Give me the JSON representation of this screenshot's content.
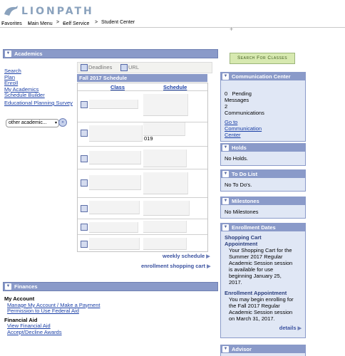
{
  "app": {
    "logo_text": "LIONPATH"
  },
  "nav": {
    "favorites": "Favorites",
    "main_menu": "Main Menu",
    "self_service": "Self Service",
    "student_center": "Student Center",
    "sep": ">"
  },
  "academics": {
    "header": "Academics",
    "links": [
      "Search",
      "Plan",
      "Enroll",
      "My Academics",
      "Schedule Builder"
    ],
    "eps": "Educational Planning Survey",
    "select_value": "other academic...",
    "go_label": "»"
  },
  "schedule": {
    "tab_deadlines": "Deadlines",
    "tab_url": "URL",
    "title": "Fall 2017 Schedule",
    "col_class": "Class",
    "col_schedule": "Schedule",
    "visible_code": "019",
    "weekly_link": "weekly schedule",
    "cart_link": "enrollment shopping cart"
  },
  "finances": {
    "header": "Finances",
    "my_account": "My Account",
    "my_account_links": [
      "Manage My Account / Make a Payment",
      "Permission to Use Federal Aid"
    ],
    "financial_aid": "Financial Aid",
    "financial_aid_links": [
      "View Financial Aid",
      "Accept/Decline Awards"
    ]
  },
  "right": {
    "search_button": "Search For Classes",
    "comm": {
      "header": "Communication Center",
      "pending_count": "0",
      "pending_label": "Pending",
      "messages_label": "Messages",
      "comm_count": "2",
      "comm_label": "Communications",
      "goto_line1": "Go to",
      "goto_line2": "Communication",
      "goto_line3": "Center"
    },
    "holds": {
      "header": "Holds",
      "text": "No Holds."
    },
    "todo": {
      "header": "To Do List",
      "text": "No To Do's."
    },
    "milestones": {
      "header": "Milestones",
      "text": "No Milestones"
    },
    "enrollment": {
      "header": "Enrollment Dates",
      "cart_title_1": "Shopping Cart",
      "cart_title_2": "Appointment",
      "cart_lines": [
        "Your Shopping Cart for the",
        "Summer 2017 Regular",
        "Academic Session session",
        "is available for use",
        "beginning January 25,",
        "2017."
      ],
      "enroll_title": "Enrollment Appointment",
      "enroll_lines": [
        "You may begin enrolling for",
        "the Fall 2017 Regular",
        "Academic Session session",
        "on March 31, 2017."
      ],
      "details": "details"
    },
    "advisor": {
      "header": "Advisor"
    }
  },
  "colors": {
    "header_bg": "#8a9ac9",
    "panel_bg": "#e0e7f5",
    "link": "#1a3fa6",
    "search_btn_bg": "#d7e9b0"
  }
}
